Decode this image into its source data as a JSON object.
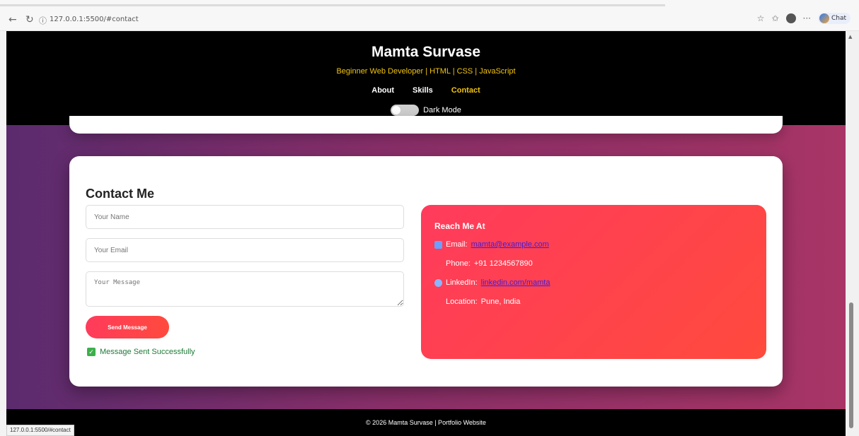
{
  "browser": {
    "url": "127.0.0.1:5500/#contact",
    "status_url": "127.0.0.1:5500/#contact",
    "back_icon": "back-arrow-icon",
    "refresh_icon": "refresh-icon",
    "info_icon": "info-icon",
    "copilot_label": "Chat"
  },
  "header": {
    "title": "Mamta Survase",
    "subtitle": "Beginner Web Developer | HTML | CSS | JavaScript",
    "nav": [
      {
        "label": "About"
      },
      {
        "label": "Skills"
      },
      {
        "label": "Contact"
      }
    ],
    "dark_mode_label": "Dark Mode"
  },
  "contact": {
    "title": "Contact Me",
    "name_placeholder": "Your Name",
    "email_placeholder": "Your Email",
    "message_placeholder": "Your Message",
    "send_label": "Send Message",
    "success_text": "Message Sent Successfully",
    "reach": {
      "title": "Reach Me At",
      "email_label": "Email:",
      "email_value": "mamta@example.com",
      "phone_label": "Phone:",
      "phone_value": "+91 1234567890",
      "linkedin_label": "LinkedIn:",
      "linkedin_value": "linkedin.com/mamta",
      "location_label": "Location:",
      "location_value": "Pune, India"
    }
  },
  "footer": {
    "text": "© 2026 Mamta Survase | Portfolio Website"
  },
  "colors": {
    "accent": "#f1c40f",
    "button": "#ff3b5c",
    "success": "#1f7a38"
  }
}
